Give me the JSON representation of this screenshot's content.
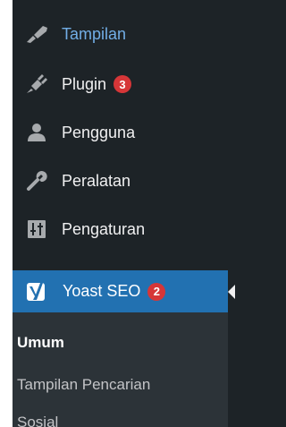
{
  "menu": {
    "items": [
      {
        "label": "Tampilan",
        "icon": "paintbrush-icon"
      },
      {
        "label": "Plugin",
        "icon": "plugin-icon",
        "badge": "3"
      },
      {
        "label": "Pengguna",
        "icon": "users-icon"
      },
      {
        "label": "Peralatan",
        "icon": "wrench-icon"
      },
      {
        "label": "Pengaturan",
        "icon": "sliders-icon"
      }
    ],
    "current": {
      "label": "Yoast SEO",
      "icon": "yoast-icon",
      "badge": "2"
    },
    "submenu": [
      "Umum",
      "Tampilan Pencarian",
      "Sosial"
    ]
  },
  "colors": {
    "background": "#1d2327",
    "highlight": "#2271b1",
    "hover_text": "#72aee6",
    "badge": "#d63638",
    "submenu_bg": "#2c3338"
  }
}
